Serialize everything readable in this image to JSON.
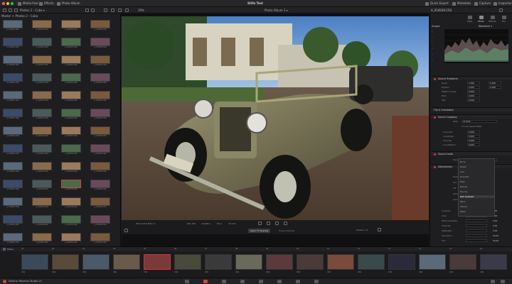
{
  "topbar": {
    "items": [
      "Media Pool",
      "Effects",
      "Photo Album"
    ],
    "title": "Stills Test",
    "right_items": [
      "Quick Export",
      "Metadata",
      "Capture",
      "Inspector"
    ]
  },
  "toolbar": {
    "album_left": "Photos 2 - Cuba",
    "zoom": "39%",
    "album_center": "Photo Album 3",
    "filename": "A_010039.CR2"
  },
  "browser": {
    "breadcrumb": "Master > Photos 2 - Cuba"
  },
  "viewer": {
    "meta": [
      "ISO 100",
      "1/1000 s",
      "f/5.2",
      "24 mm"
    ],
    "timecode": "ISO 6.18 6 Mark 3",
    "tab_active": "Open FX Overlay",
    "tab_inactive": "Fusion Overlay",
    "version": "Version 1"
  },
  "inspector": {
    "tabs": [
      "Stills",
      "Photo",
      "Effects",
      "File"
    ],
    "scopes_title": "Scopes",
    "scope_type": "Waveform",
    "sections": {
      "source_transform": "Source Transform",
      "flip": "Flip & Orientation",
      "source_cropping": "Source Cropping",
      "source_looks": "Source Looks",
      "adjustments": "Adjustments"
    },
    "transform_rows": [
      {
        "label": "Zoom",
        "x": "1.000",
        "y": "1.000"
      },
      {
        "label": "Position",
        "x": "0.000",
        "y": "0.000"
      },
      {
        "label": "Rotation Angle",
        "x": "0.000",
        "y": ""
      },
      {
        "label": "Pitch",
        "x": "0.000",
        "y": ""
      },
      {
        "label": "Yaw",
        "x": "0.000",
        "y": ""
      }
    ],
    "ratio_label": "Ratio",
    "ratio_value": "As Shot",
    "lock_aspect": "Lock Aspect Ratio",
    "crop_rows": [
      {
        "label": "Crop Left",
        "value": "0.000"
      },
      {
        "label": "Crop Right",
        "value": "0.000"
      },
      {
        "label": "Crop Top",
        "value": "0.000"
      },
      {
        "label": "Crop Bottom",
        "value": "0.000"
      }
    ],
    "look_type_label": "Type",
    "look_type_value": "Rich Contrast",
    "adjust_rows": [
      {
        "label": "Temp",
        "value": ""
      },
      {
        "label": "Tint",
        "value": ""
      },
      {
        "label": "Lift",
        "value": ""
      },
      {
        "label": "Gamma",
        "value": ""
      },
      {
        "label": "Gain",
        "value": ""
      }
    ],
    "bottom_rows": [
      {
        "label": "Contrast",
        "value": "0.00"
      },
      {
        "label": "Color",
        "value": "0.00"
      },
      {
        "label": "Midtone Details",
        "value": "0.00"
      },
      {
        "label": "Shadows",
        "value": "0.00"
      },
      {
        "label": "Highlights",
        "value": "0.00"
      },
      {
        "label": "Saturation",
        "value": "50.00"
      },
      {
        "label": "Hue",
        "value": "50.00"
      }
    ],
    "dropdown_options": [
      "None",
      "Bright",
      "Cool",
      "Dramatic",
      "Fade",
      "Natural",
      "Punchy",
      "Rich Contrast",
      "Retro",
      "Vibrant",
      "Warm"
    ]
  },
  "filmstrip": {
    "filter": "Filters",
    "numbers": [
      "01",
      "02",
      "03",
      "04",
      "05",
      "06",
      "07",
      "08",
      "09",
      "10",
      "11",
      "12",
      "13",
      "14",
      "15",
      "16"
    ],
    "labels": [
      "CR2",
      "CR2",
      "CR2",
      "CR2",
      "CR2",
      "CR2",
      "CR2",
      "CR2",
      "CR2",
      "CR2",
      "CR2",
      "CR2",
      "CR2",
      "CR2",
      "CR2",
      "CR2"
    ]
  },
  "status": {
    "app": "DaVinci Resolve Studio 21"
  },
  "thumbs": [
    "A_010001.CR2",
    "A_010002.CR2",
    "A_010003.CR2",
    "A_010004.CR2",
    "A_010005.CR2",
    "A_010006.CR2",
    "A_010007.CR2",
    "A_010008.CR2",
    "A_010009.CR2",
    "A_010010.CR2",
    "A_010011.CR2",
    "A_010012.CR2",
    "A_010013.CR2",
    "A_010014.CR2",
    "A_010015.CR2",
    "A_010016.CR2",
    "A_010017.CR2",
    "A_010018.CR2",
    "A_010019.CR2",
    "A_010020.CR2",
    "A_010021.CR2",
    "A_010022.CR2",
    "A_010023.CR2",
    "A_010024.CR2",
    "A_010025.CR2",
    "A_010026.CR2",
    "A_010027.CR2",
    "A_010028.CR2",
    "A_010029.CR2",
    "A_010030.CR2",
    "A_010031.CR2",
    "A_010032.CR2",
    "A_010033.CR2",
    "A_010034.CR2",
    "A_010035.CR2",
    "A_010036.CR2",
    "A_010037.CR2",
    "A_010038.CR2",
    "A_010039.CR2",
    "A_010040.CR2",
    "A_010041.CR2",
    "A_010042.CR2",
    "A_010043.CR2",
    "A_010044.CR2",
    "A_010045.CR2",
    "A_010046.CR2",
    "A_010047.CR2",
    "A_010048.CR2",
    "A_010049.CR2",
    "A_010050.CR2",
    "A_010051.CR2",
    "A_010052.CR2",
    "A_010053.CR2",
    "A_010054.CR2",
    "A_010055.CR2",
    "A_010056.CR2",
    "A_010057.CR2",
    "A_010058.CR2",
    "A_010059.CR2",
    "A_010060.CR2",
    "A_010061.CR2",
    "A_010062.CR2",
    "A_010063.CR2",
    "A_010064.CR2",
    "A_010065.CR2",
    "A_010066.CR2",
    "A_010067.CR2",
    "A_010068.CR2",
    "A_010069.CR2",
    "A_010070.CR2",
    "A_010071.CR2",
    "A_010072.CR2",
    "A_010073.CR2",
    "A_010074.CR2",
    "A_010075.CR2",
    "A_010076.CR2",
    "A_010077.CR2",
    "A_010078.CR2",
    "A_010079.CR2",
    "A_010080.CR2",
    "A_010081.CR2",
    "A_010082.CR2",
    "A_010083.CR2",
    "A_010084.CR2",
    "A_010085.CR2",
    "A_010086.CR2",
    "A_010087.CR2",
    "A_010088.CR2",
    "A_010089.CR2",
    "A_010090.CR2",
    "A_010091.CR2",
    "A_010092.CR2",
    "A_010093.CR2",
    "A_010094.CR2",
    "A_010095.CR2",
    "A_010096.CR2",
    "A_010097.CR2",
    "A_010098.CR2",
    "A_010099.CR2",
    "A_010100.CR2",
    "A_010101.CR2",
    "A_010102.CR2",
    "A_010103.CR2",
    "A_010104.CR2",
    "A_010105.CR2",
    "A_010106.CR2",
    "A_010107.CR2",
    "A_010108.CR2",
    "A_010109.CR2",
    "A_010110.CR2",
    "A_010111.CR2",
    "A_010112.CR2",
    "A_010113.CR2",
    "A_010114.CR2",
    "A_010115.CR2",
    "A_010116.CR2",
    "A_010117.CR2",
    "A_010118.CR2",
    "A_010119.CR2",
    "A_010120.CR2",
    "A_010121.CR2",
    "A_010122.CR2",
    "A_010123.CR2",
    "A_010124.CR2",
    "A_010125.CR2",
    "A_010126.CR2",
    "A_010127.CR2",
    "A_010128.CR2"
  ],
  "colors": {
    "accent_red": "#d33333",
    "panel": "#1e1e21",
    "selected_thumb": "#c64a3a"
  }
}
